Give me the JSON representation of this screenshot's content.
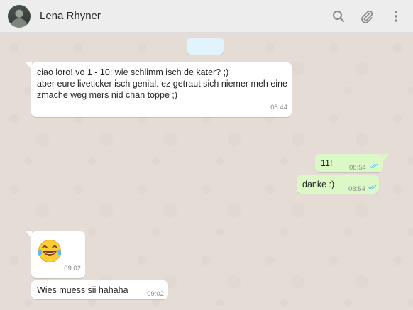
{
  "header": {
    "contact_name": "Lena Rhyner",
    "icons": [
      "search-icon",
      "attach-icon",
      "menu-icon"
    ]
  },
  "messages": [
    {
      "direction": "in",
      "lines": [
        "ciao loro! vo 1 - 10: wie schlimm isch de kater? ;)",
        "aber eure liveticker isch genial. ez getraut sich niemer meh eine",
        "zmache weg mers nid chan toppe ;)"
      ],
      "time": "08:44"
    },
    {
      "direction": "out",
      "text": "11!",
      "time": "08:54",
      "status": "read"
    },
    {
      "direction": "out",
      "text": "danke :)",
      "time": "08:54",
      "status": "read"
    },
    {
      "direction": "in",
      "emoji": "😂",
      "emoji_name": "laughing-tears-emoji",
      "time": "09:02"
    },
    {
      "direction": "in",
      "text": "Wies muess sii hahaha",
      "time": "09:02"
    }
  ],
  "colors": {
    "header_bg": "#ededed",
    "chat_bg": "#e5ddd5",
    "incoming_bubble": "#ffffff",
    "outgoing_bubble": "#dcf8c6",
    "date_chip": "#e1f3fb",
    "read_ticks": "#4fc3f7"
  }
}
